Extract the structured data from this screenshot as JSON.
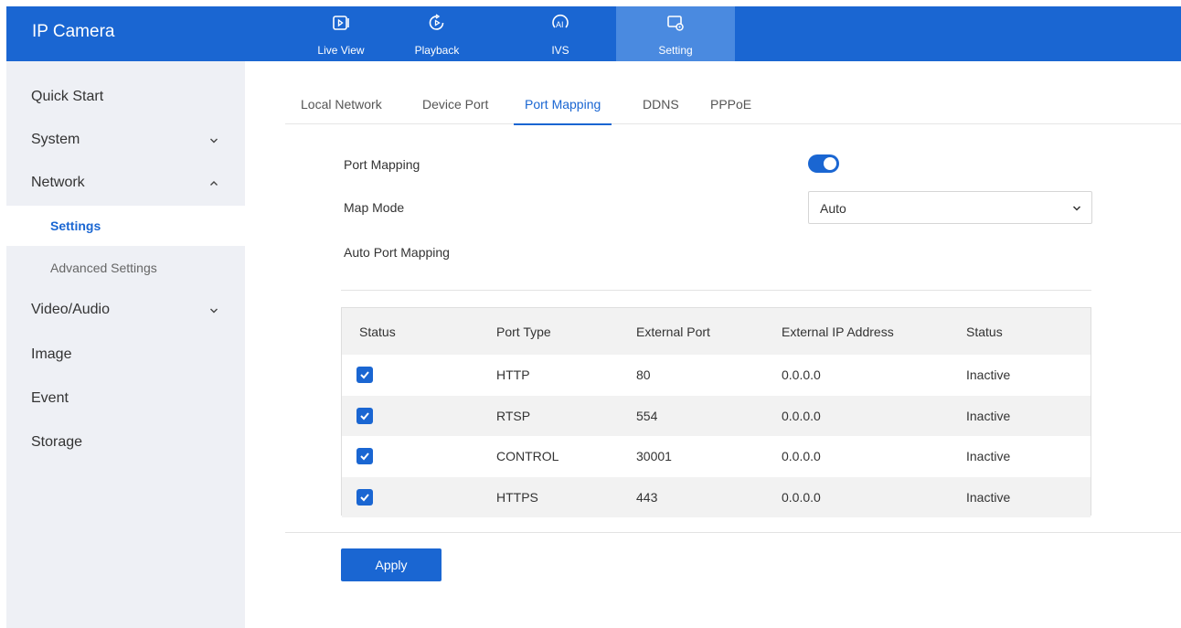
{
  "app": {
    "title": "IP Camera"
  },
  "topnav": {
    "items": [
      {
        "label": "Live View",
        "icon": "live-view-icon"
      },
      {
        "label": "Playback",
        "icon": "playback-icon"
      },
      {
        "label": "IVS",
        "icon": "ivs-ai-icon"
      },
      {
        "label": "Setting",
        "icon": "setting-icon",
        "active": true
      }
    ]
  },
  "sidebar": {
    "items": [
      {
        "label": "Quick Start"
      },
      {
        "label": "System",
        "chevron": "down"
      },
      {
        "label": "Network",
        "chevron": "up",
        "children": [
          {
            "label": "Settings",
            "active": true
          },
          {
            "label": "Advanced Settings"
          }
        ]
      },
      {
        "label": "Video/Audio",
        "chevron": "down"
      },
      {
        "label": "Image"
      },
      {
        "label": "Event"
      },
      {
        "label": "Storage"
      }
    ]
  },
  "tabs": [
    {
      "label": "Local Network"
    },
    {
      "label": "Device Port"
    },
    {
      "label": "Port Mapping",
      "active": true
    },
    {
      "label": "DDNS"
    },
    {
      "label": "PPPoE"
    }
  ],
  "form": {
    "port_mapping_label": "Port Mapping",
    "port_mapping_enabled": true,
    "map_mode_label": "Map Mode",
    "map_mode_value": "Auto",
    "auto_port_mapping_label": "Auto Port Mapping"
  },
  "table": {
    "headers": [
      "Status",
      "Port Type",
      "External Port",
      "External IP Address",
      "Status"
    ],
    "rows": [
      {
        "checked": true,
        "port_type": "HTTP",
        "external_port": "80",
        "external_ip": "0.0.0.0",
        "status": "Inactive"
      },
      {
        "checked": true,
        "port_type": "RTSP",
        "external_port": "554",
        "external_ip": "0.0.0.0",
        "status": "Inactive"
      },
      {
        "checked": true,
        "port_type": "CONTROL",
        "external_port": "30001",
        "external_ip": "0.0.0.0",
        "status": "Inactive"
      },
      {
        "checked": true,
        "port_type": "HTTPS",
        "external_port": "443",
        "external_ip": "0.0.0.0",
        "status": "Inactive"
      }
    ]
  },
  "actions": {
    "apply_label": "Apply"
  },
  "colors": {
    "brand": "#1a66d2",
    "active_tab_bg": "#4a8ae0",
    "sidebar_bg": "#eef0f5"
  }
}
